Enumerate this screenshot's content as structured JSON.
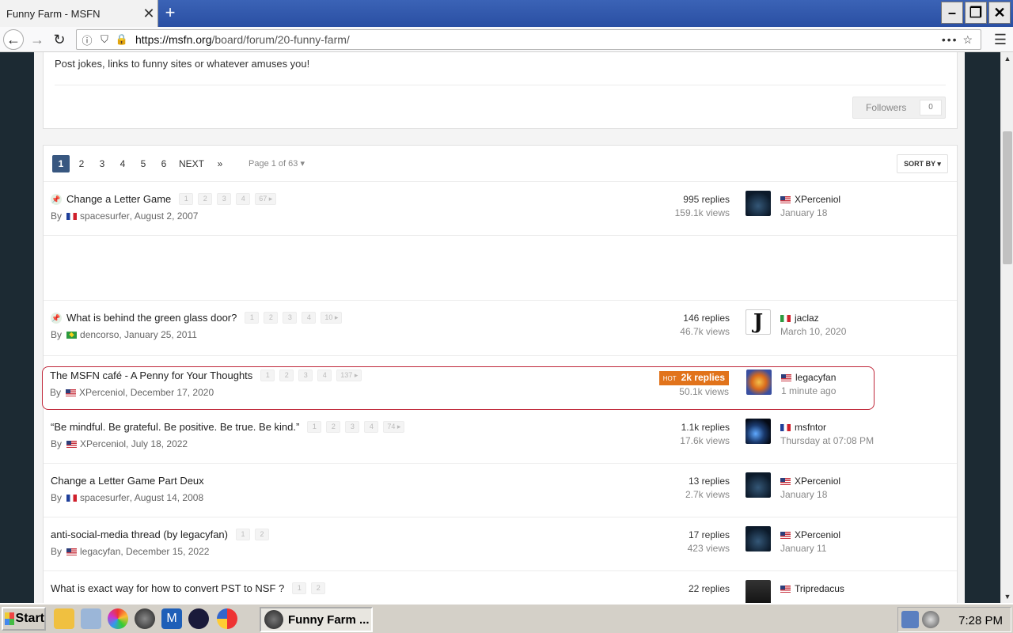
{
  "browser": {
    "tab_title": "Funny Farm - MSFN",
    "tab_close": "✕",
    "new_tab": "+",
    "url_host": "https://msfn.org",
    "url_path": "/board/forum/20-funny-farm/",
    "page_actions": "•••  ☆",
    "menu": "☰"
  },
  "forum": {
    "description": "Post jokes, links to funny sites or whatever amuses you!",
    "followers_label": "Followers",
    "followers_count": "0"
  },
  "pagination": {
    "pages": [
      "1",
      "2",
      "3",
      "4",
      "5",
      "6"
    ],
    "next": "NEXT",
    "last": "»",
    "page_of": "Page 1 of 63 ▾",
    "sort_by": "SORT BY ▾"
  },
  "topics": [
    {
      "title": "Change a Letter Game",
      "pinned": true,
      "pages": [
        "1",
        "2",
        "3",
        "4",
        "67 ▸"
      ],
      "by": "By",
      "author": "spacesurfer",
      "author_flag": "fr",
      "date": ", August 2, 2007",
      "replies": "995 replies",
      "views": "159.1k views",
      "last_user": "XPerceniol",
      "last_flag": "us",
      "last_time": "January 18",
      "avatar": "dark"
    },
    {
      "title": "What is behind the green glass door?",
      "pinned": true,
      "pages": [
        "1",
        "2",
        "3",
        "4",
        "10 ▸"
      ],
      "by": "By",
      "author": "dencorso",
      "author_flag": "br",
      "date": ", January 25, 2011",
      "replies": "146 replies",
      "views": "46.7k views",
      "last_user": "jaclaz",
      "last_flag": "it",
      "last_time": "March 10, 2020",
      "avatar": "j"
    },
    {
      "title": "The MSFN café - A Penny for Your Thoughts",
      "pinned": false,
      "pages": [
        "1",
        "2",
        "3",
        "4",
        "137 ▸"
      ],
      "by": "By",
      "author": "XPerceniol",
      "author_flag": "us",
      "date": ", December 17, 2020",
      "hot_label": "HOT",
      "replies": "2k replies",
      "views": "50.1k views",
      "last_user": "legacyfan",
      "last_flag": "us",
      "last_time": "1 minute ago",
      "avatar": "fox"
    },
    {
      "title": "“Be mindful. Be grateful. Be positive. Be true. Be kind.”",
      "pinned": false,
      "pages": [
        "1",
        "2",
        "3",
        "4",
        "74 ▸"
      ],
      "by": "By",
      "author": "XPerceniol",
      "author_flag": "us",
      "date": ", July 18, 2022",
      "replies": "1.1k replies",
      "views": "17.6k views",
      "last_user": "msfntor",
      "last_flag": "fr",
      "last_time": "Thursday at 07:08 PM",
      "avatar": "blue"
    },
    {
      "title": "Change a Letter Game Part Deux",
      "pinned": false,
      "pages": [],
      "by": "By",
      "author": "spacesurfer",
      "author_flag": "fr",
      "date": ", August 14, 2008",
      "replies": "13 replies",
      "views": "2.7k views",
      "last_user": "XPerceniol",
      "last_flag": "us",
      "last_time": "January 18",
      "avatar": "dark"
    },
    {
      "title": "anti-social-media thread (by legacyfan)",
      "pinned": false,
      "pages": [
        "1",
        "2"
      ],
      "by": "By",
      "author": "legacyfan",
      "author_flag": "us",
      "date": ", December 15, 2022",
      "replies": "17 replies",
      "views": "423 views",
      "last_user": "XPerceniol",
      "last_flag": "us",
      "last_time": "January 11",
      "avatar": "dark"
    },
    {
      "title": "What is exact way for how to convert PST to NSF ?",
      "pinned": false,
      "pages": [
        "1",
        "2"
      ],
      "by": "",
      "author": "",
      "author_flag": "",
      "date": "",
      "replies": "22 replies",
      "views": "",
      "last_user": "Tripredacus",
      "last_flag": "us",
      "last_time": "",
      "avatar": "pred"
    }
  ],
  "taskbar": {
    "start": "Start",
    "task_title": "Funny Farm ...",
    "clock": "7:28 PM"
  },
  "colors": {
    "active_page": "#385780",
    "hot_badge": "#e1731b",
    "highlight_border": "#c0283a"
  }
}
